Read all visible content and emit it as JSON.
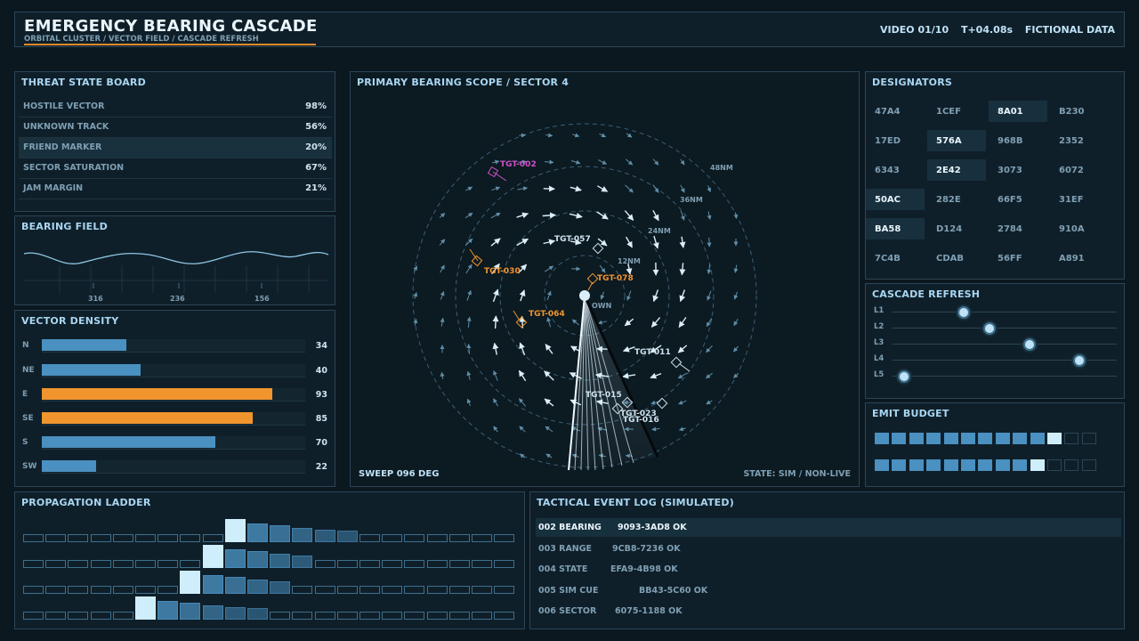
{
  "header": {
    "title": "EMERGENCY BEARING CASCADE",
    "subtitle": "ORBITAL CLUSTER / VECTOR FIELD / CASCADE REFRESH",
    "video": "VIDEO 01/10",
    "time": "T+04.08s",
    "notice": "FICTIONAL DATA"
  },
  "threat_board": {
    "title": "THREAT STATE BOARD",
    "rows": [
      {
        "label": "HOSTILE VECTOR",
        "value": "98%"
      },
      {
        "label": "UNKNOWN TRACK",
        "value": "56%"
      },
      {
        "label": "FRIEND MARKER",
        "value": "20%"
      },
      {
        "label": "SECTOR SATURATION",
        "value": "67%"
      },
      {
        "label": "JAM MARGIN",
        "value": "21%"
      }
    ]
  },
  "bearing_field": {
    "title": "BEARING FIELD",
    "ticks": [
      "316",
      "236",
      "156"
    ]
  },
  "vector_density": {
    "title": "VECTOR DENSITY",
    "rows": [
      {
        "label": "N",
        "value": "34",
        "level": 34,
        "color": "#4a90c0"
      },
      {
        "label": "NE",
        "value": "40",
        "level": 40,
        "color": "#4a90c0"
      },
      {
        "label": "E",
        "value": "93",
        "level": 93,
        "color": "#f0952e"
      },
      {
        "label": "SE",
        "value": "85",
        "level": 85,
        "color": "#f0952e"
      },
      {
        "label": "S",
        "value": "70",
        "level": 70,
        "color": "#4a90c0"
      },
      {
        "label": "SW",
        "value": "22",
        "level": 22,
        "color": "#4a90c0"
      }
    ]
  },
  "scope": {
    "title": "PRIMARY BEARING SCOPE / SECTOR 4",
    "sweep": "SWEEP 096 DEG",
    "state": "STATE: SIM / NON-LIVE",
    "own_label": "OWN",
    "ring_labels": [
      "12NM",
      "24NM",
      "36NM",
      "48NM"
    ],
    "targets": [
      {
        "id": "TGT-002",
        "color": "#d04fc8"
      },
      {
        "id": "TGT-057",
        "color": "#cfe3ef"
      },
      {
        "id": "TGT-030",
        "color": "#f0952e"
      },
      {
        "id": "TGT-078",
        "color": "#f0952e"
      },
      {
        "id": "TGT-064",
        "color": "#f0952e"
      },
      {
        "id": "TGT-011",
        "color": "#cfe3ef"
      },
      {
        "id": "TGT-015",
        "color": "#cfe3ef"
      },
      {
        "id": "TGT-023",
        "color": "#cfe3ef"
      },
      {
        "id": "TGT-016",
        "color": "#cfe3ef"
      }
    ]
  },
  "designators": {
    "title": "DESIGNATORS",
    "cells": [
      {
        "code": "47A4",
        "hl": false
      },
      {
        "code": "1CEF",
        "hl": false
      },
      {
        "code": "8A01",
        "hl": true
      },
      {
        "code": "B230",
        "hl": false
      },
      {
        "code": "17ED",
        "hl": false
      },
      {
        "code": "576A",
        "hl": true
      },
      {
        "code": "968B",
        "hl": false
      },
      {
        "code": "2352",
        "hl": false
      },
      {
        "code": "6343",
        "hl": false
      },
      {
        "code": "2E42",
        "hl": true
      },
      {
        "code": "3073",
        "hl": false
      },
      {
        "code": "6072",
        "hl": false
      },
      {
        "code": "50AC",
        "hl": true
      },
      {
        "code": "282E",
        "hl": false
      },
      {
        "code": "66F5",
        "hl": false
      },
      {
        "code": "31EF",
        "hl": false
      },
      {
        "code": "BA58",
        "hl": true
      },
      {
        "code": "D124",
        "hl": false
      },
      {
        "code": "2784",
        "hl": false
      },
      {
        "code": "910A",
        "hl": false
      },
      {
        "code": "7C4B",
        "hl": false
      },
      {
        "code": "CDAB",
        "hl": false
      },
      {
        "code": "56FF",
        "hl": false
      },
      {
        "code": "A891",
        "hl": false
      }
    ]
  },
  "cascade_refresh": {
    "title": "CASCADE REFRESH",
    "sliders": [
      {
        "label": "L1",
        "level": 0.3
      },
      {
        "label": "L2",
        "level": 0.43
      },
      {
        "label": "L3",
        "level": 0.63
      },
      {
        "label": "L4",
        "level": 0.88
      },
      {
        "label": "L5",
        "level": 0.0
      }
    ]
  },
  "emit_budget": {
    "title": "EMIT BUDGET",
    "rows": [
      {
        "filled": 11,
        "total": 13
      },
      {
        "filled": 10,
        "total": 13
      }
    ]
  },
  "propagation_ladder": {
    "title": "PROPAGATION LADDER",
    "rows": [
      {
        "levels": [
          0,
          0,
          0,
          0,
          0,
          0,
          0,
          0,
          0,
          1.0,
          0.7,
          0.55,
          0.4,
          0.28,
          0.2,
          0,
          0,
          0,
          0,
          0,
          0,
          0
        ]
      },
      {
        "levels": [
          0,
          0,
          0,
          0,
          0,
          0,
          0,
          0,
          1.0,
          0.7,
          0.55,
          0.4,
          0.28,
          0,
          0,
          0,
          0,
          0,
          0,
          0,
          0,
          0
        ]
      },
      {
        "levels": [
          0,
          0,
          0,
          0,
          0,
          0,
          0,
          1.0,
          0.7,
          0.55,
          0.4,
          0.28,
          0,
          0,
          0,
          0,
          0,
          0,
          0,
          0,
          0,
          0
        ]
      },
      {
        "levels": [
          0,
          0,
          0,
          0,
          0,
          1.0,
          0.7,
          0.55,
          0.4,
          0.28,
          0.2,
          0,
          0,
          0,
          0,
          0,
          0,
          0,
          0,
          0,
          0,
          0
        ]
      }
    ]
  },
  "event_log": {
    "title": "TACTICAL EVENT LOG (SIMULATED)",
    "rows": [
      {
        "event": "002 BEARING",
        "code": "9093-3AD8 OK",
        "selected": true
      },
      {
        "event": "003 RANGE",
        "code": "9CB8-7236 OK",
        "selected": false
      },
      {
        "event": "004 STATE",
        "code": "EFA9-4B98 OK",
        "selected": false
      },
      {
        "event": "005 SIM CUE",
        "code": "BB43-5C60 OK",
        "selected": false
      },
      {
        "event": "006 SECTOR",
        "code": "6075-1188 OK",
        "selected": false
      }
    ]
  }
}
